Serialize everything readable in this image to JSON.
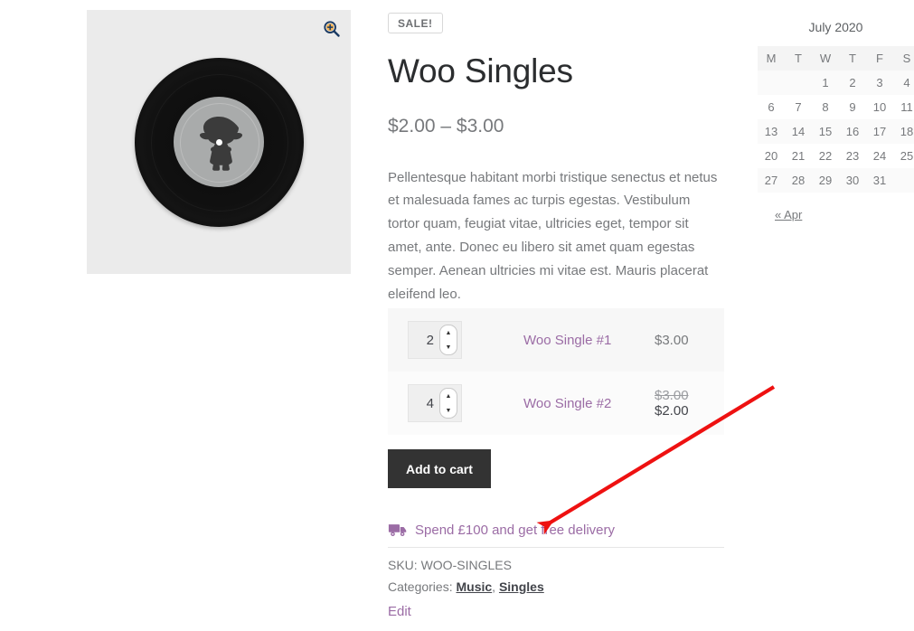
{
  "gallery": {
    "zoom_icon": "zoom-in-icon",
    "product_image_alt": "vinyl-record"
  },
  "product": {
    "sale_badge": "SALE!",
    "title": "Woo Singles",
    "price_range": "$2.00 – $3.00",
    "description": "Pellentesque habitant morbi tristique senectus et netus et malesuada fames ac turpis egestas. Vestibulum tortor quam, feugiat vitae, ultricies eget, tempor sit amet, ante. Donec eu libero sit amet quam egestas semper. Aenean ultricies mi vitae est. Mauris placerat eleifend leo.",
    "add_to_cart_label": "Add to cart",
    "grouped_items": [
      {
        "quantity": "2",
        "name": "Woo Single #1",
        "price": "$3.00",
        "price_old": "",
        "price_new": ""
      },
      {
        "quantity": "4",
        "name": "Woo Single #2",
        "price": "",
        "price_old": "$3.00",
        "price_new": "$2.00"
      }
    ],
    "delivery_notice": {
      "icon": "truck-icon",
      "text": "Spend £100 and get free delivery"
    },
    "meta": {
      "sku_label": "SKU:",
      "sku_value": "WOO-SINGLES",
      "categories_label": "Categories:",
      "categories": [
        "Music",
        "Singles"
      ],
      "category_separator": ", "
    },
    "edit_label": "Edit"
  },
  "calendar": {
    "caption": "July 2020",
    "weekdays": [
      "M",
      "T",
      "W",
      "T",
      "F",
      "S"
    ],
    "weeks": [
      [
        "",
        "",
        "1",
        "2",
        "3",
        "4"
      ],
      [
        "6",
        "7",
        "8",
        "9",
        "10",
        "11"
      ],
      [
        "13",
        "14",
        "15",
        "16",
        "17",
        "18"
      ],
      [
        "20",
        "21",
        "22",
        "23",
        "24",
        "25"
      ],
      [
        "27",
        "28",
        "29",
        "30",
        "31",
        ""
      ]
    ],
    "prev_label": "« Apr"
  },
  "annotation": {
    "arrow_color": "#ee1111"
  },
  "colors": {
    "link_purple": "#9b6ca5",
    "button_dark": "#333333",
    "text_muted": "#77797c"
  }
}
